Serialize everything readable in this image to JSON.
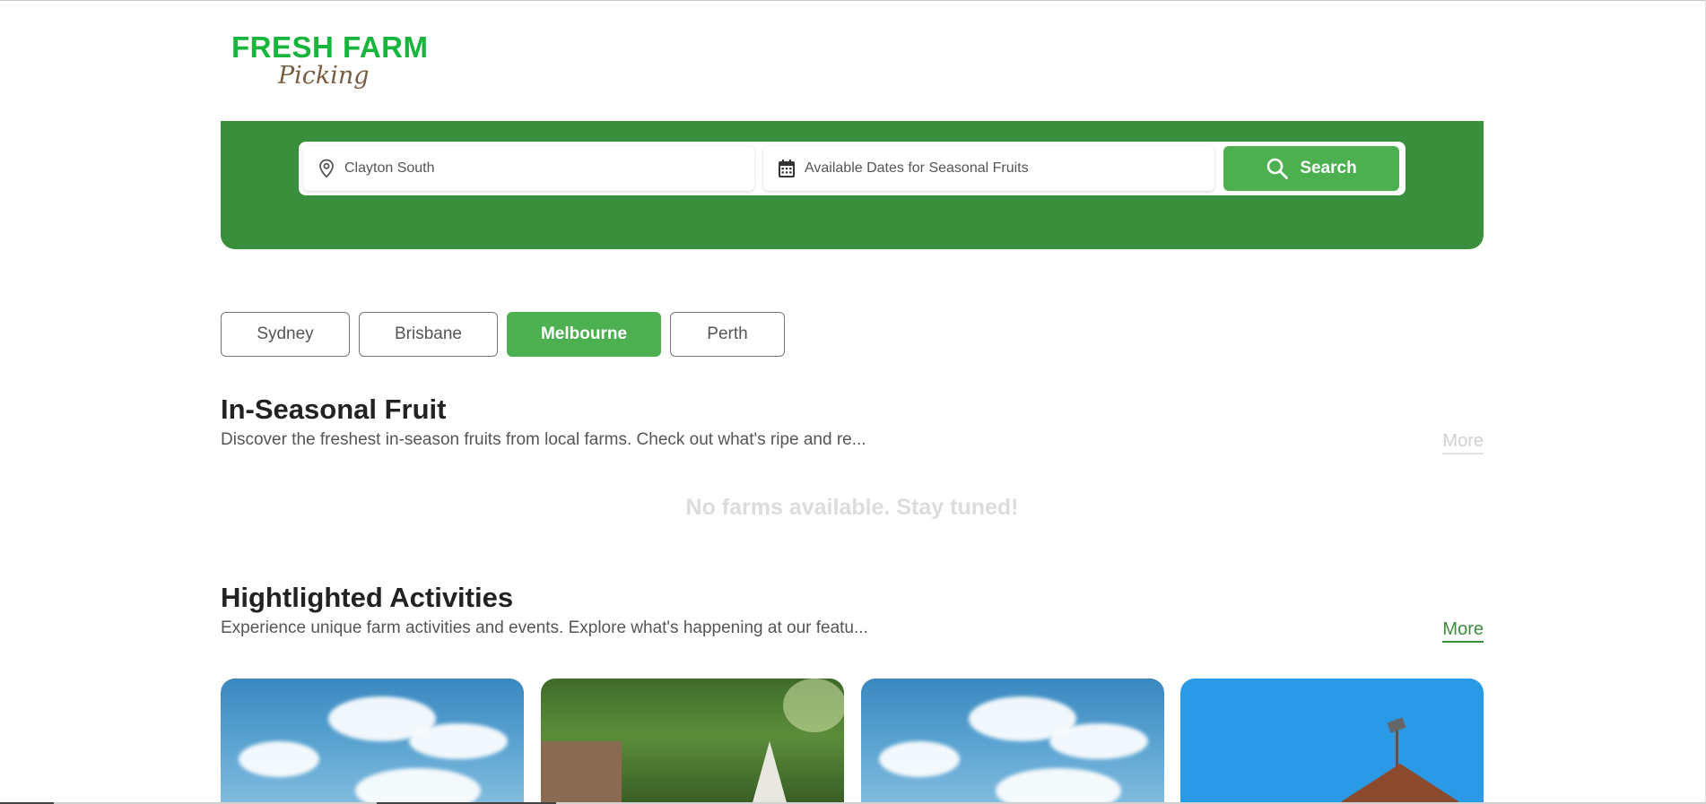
{
  "logo": {
    "line1": "FRESH FARM",
    "line2": "Picking"
  },
  "search": {
    "location_value": "Clayton South",
    "dates_placeholder": "Available Dates for Seasonal Fruits",
    "button_label": "Search"
  },
  "cities": [
    {
      "label": "Sydney",
      "active": false
    },
    {
      "label": "Brisbane",
      "active": false
    },
    {
      "label": "Melbourne",
      "active": true
    },
    {
      "label": "Perth",
      "active": false
    }
  ],
  "seasonal": {
    "title": "In-Seasonal Fruit",
    "description": "Discover the freshest in-season fruits from local farms. Check out what's ripe and re...",
    "more_label": "More",
    "empty_message": "No farms available. Stay tuned!"
  },
  "activities": {
    "title": "Hightlighted Activities",
    "description": "Experience unique farm activities and events. Explore what's happening at our featu...",
    "more_label": "More",
    "cards": [
      {
        "image": "sky-clouds"
      },
      {
        "image": "garden-graffiti"
      },
      {
        "image": "sky-clouds"
      },
      {
        "image": "barn-blue-sky"
      }
    ]
  },
  "colors": {
    "brand_green": "#3a8f3c",
    "button_green": "#4caf50",
    "logo_green": "#17b53b",
    "logo_brown": "#7a5c3e"
  },
  "icons": {
    "location": "map-pin-icon",
    "calendar": "calendar-icon",
    "search": "search-icon"
  }
}
